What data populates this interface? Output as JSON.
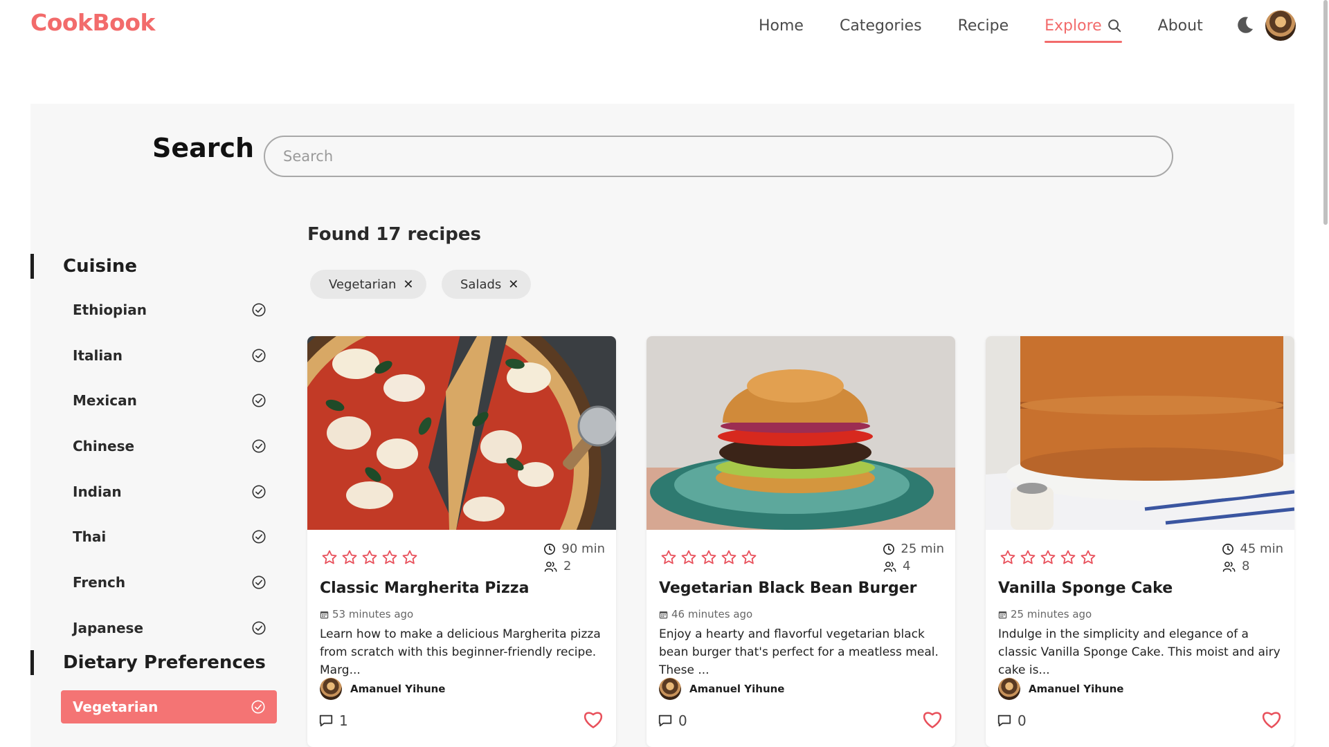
{
  "app": {
    "logo": "CookBook",
    "accent": "#f26b6b"
  },
  "nav": {
    "items": [
      {
        "label": "Home"
      },
      {
        "label": "Categories"
      },
      {
        "label": "Recipe"
      },
      {
        "label": "Explore",
        "active": true,
        "icon": "search-icon"
      },
      {
        "label": "About"
      }
    ],
    "theme_icon": "moon-icon"
  },
  "search": {
    "title": "Search",
    "placeholder": "Search",
    "value": ""
  },
  "results": {
    "found_text": "Found 17 recipes"
  },
  "active_filters": [
    {
      "label": "Vegetarian"
    },
    {
      "label": "Salads"
    }
  ],
  "sidebar": {
    "cuisine": {
      "title": "Cuisine",
      "items": [
        "Ethiopian",
        "Italian",
        "Mexican",
        "Chinese",
        "Indian",
        "Thai",
        "French",
        "Japanese"
      ]
    },
    "dietary": {
      "title": "Dietary Preferences",
      "items": [
        {
          "label": "Vegetarian",
          "selected": true
        }
      ]
    }
  },
  "recipes": [
    {
      "title": "Classic Margherita Pizza",
      "time": "90 min",
      "servings": "2",
      "posted": "53 minutes ago",
      "description": "Learn how to make a delicious Margherita pizza from scratch with this beginner-friendly recipe. Marg...",
      "author": "Amanuel Yihune",
      "comments": "1",
      "rating": 0
    },
    {
      "title": "Vegetarian Black Bean Burger",
      "time": "25 min",
      "servings": "4",
      "posted": "46 minutes ago",
      "description": "Enjoy a hearty and flavorful vegetarian black bean burger that's perfect for a meatless meal. These ...",
      "author": "Amanuel Yihune",
      "comments": "0",
      "rating": 0
    },
    {
      "title": "Vanilla Sponge Cake",
      "time": "45 min",
      "servings": "8",
      "posted": "25 minutes ago",
      "description": "Indulge in the simplicity and elegance of a classic Vanilla Sponge Cake. This moist and airy cake is...",
      "author": "Amanuel Yihune",
      "comments": "0",
      "rating": 0
    }
  ]
}
